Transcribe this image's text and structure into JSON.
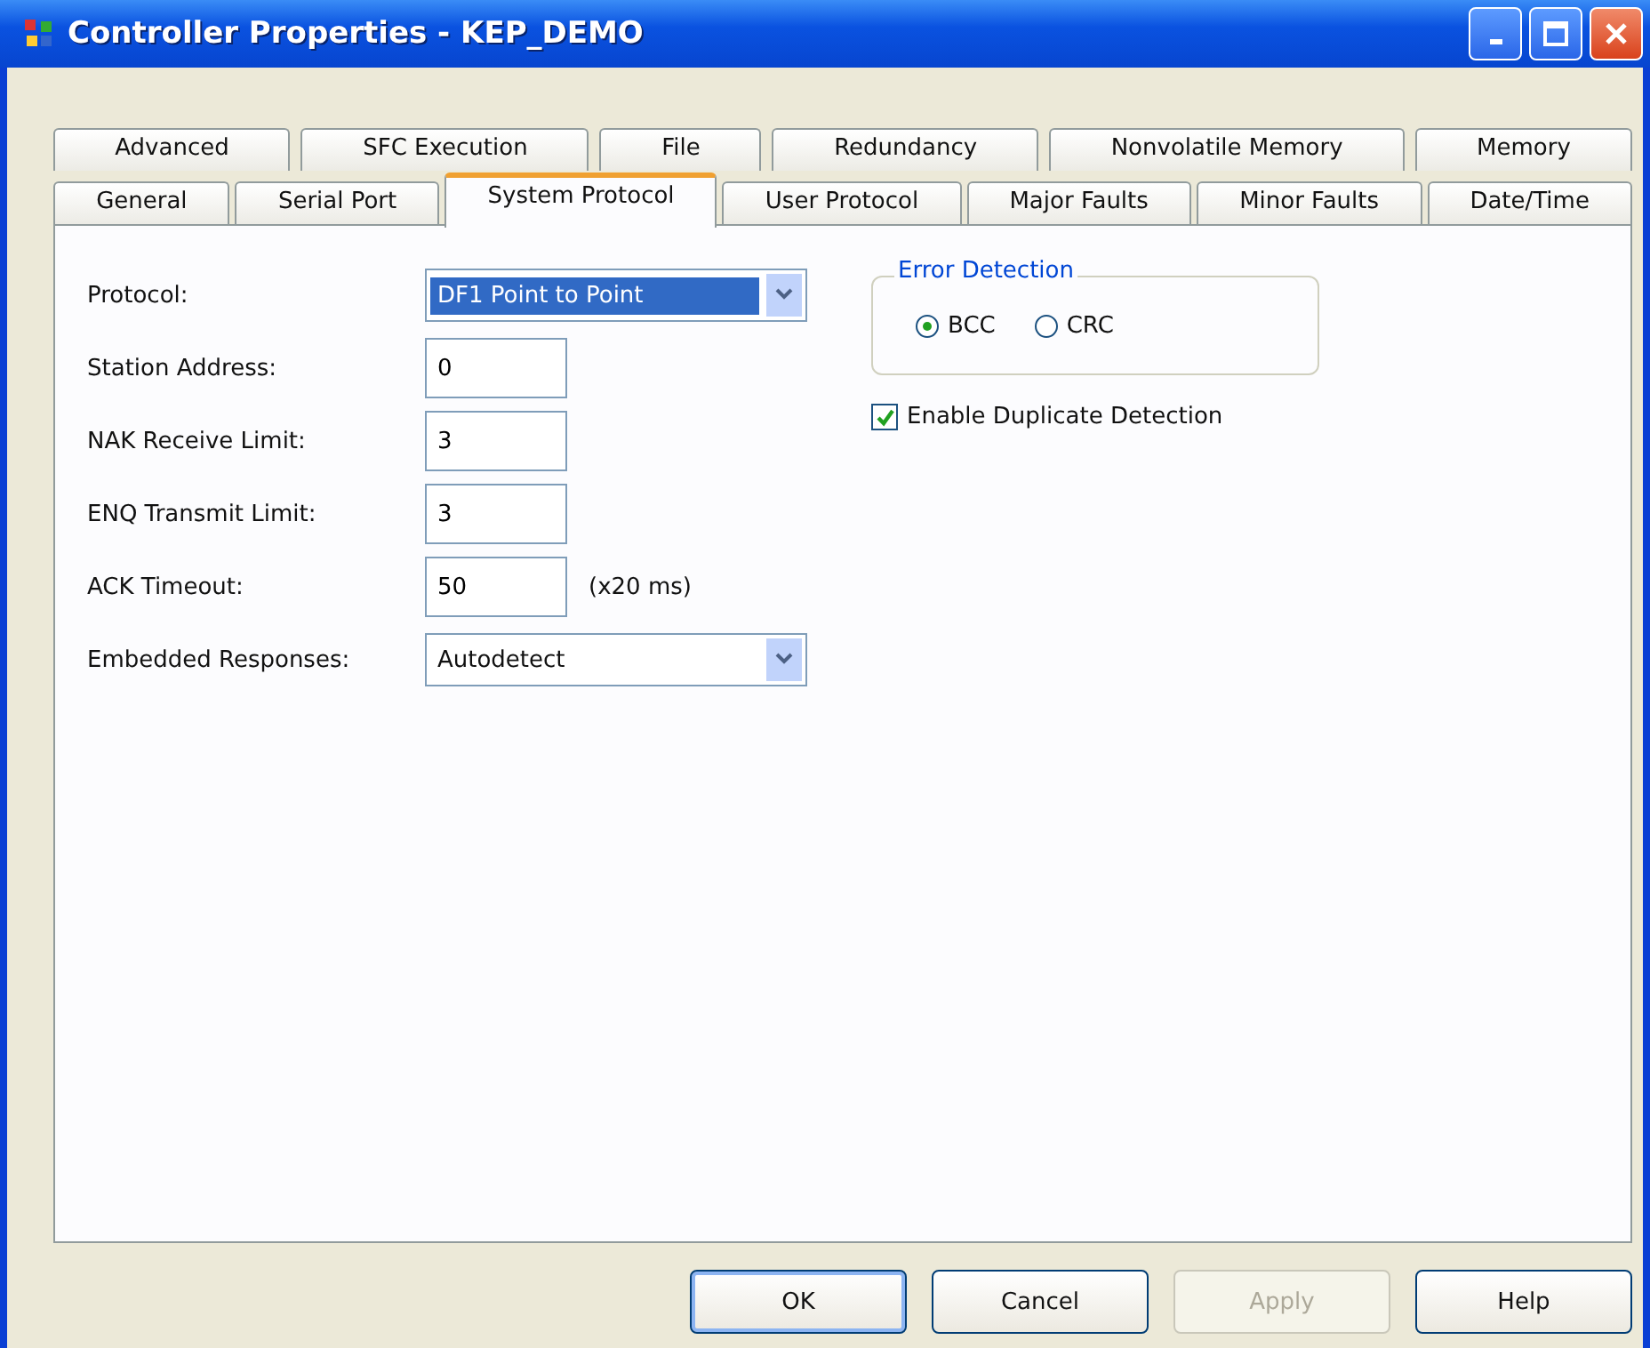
{
  "window": {
    "title": "Controller Properties - KEP_DEMO"
  },
  "tab_rows": [
    {
      "tabs": [
        {
          "label": "Advanced",
          "selected": false
        },
        {
          "label": "SFC Execution",
          "selected": false
        },
        {
          "label": "File",
          "selected": false
        },
        {
          "label": "Redundancy",
          "selected": false
        },
        {
          "label": "Nonvolatile Memory",
          "selected": false
        },
        {
          "label": "Memory",
          "selected": false
        }
      ]
    },
    {
      "tabs": [
        {
          "label": "General",
          "selected": false
        },
        {
          "label": "Serial Port",
          "selected": false
        },
        {
          "label": "System Protocol",
          "selected": true
        },
        {
          "label": "User Protocol",
          "selected": false
        },
        {
          "label": "Major Faults",
          "selected": false
        },
        {
          "label": "Minor Faults",
          "selected": false
        },
        {
          "label": "Date/Time",
          "selected": false
        }
      ]
    }
  ],
  "fields": [
    {
      "kind": "dropdown",
      "label": "Protocol:",
      "value": "DF1 Point to Point",
      "highlighted": true
    },
    {
      "kind": "text",
      "label": "Station Address:",
      "value": "0"
    },
    {
      "kind": "text",
      "label": "NAK Receive Limit:",
      "value": "3"
    },
    {
      "kind": "text",
      "label": "ENQ Transmit Limit:",
      "value": "3"
    },
    {
      "kind": "text",
      "label": "ACK Timeout:",
      "value": "50",
      "suffix": "(x20 ms)"
    },
    {
      "kind": "dropdown",
      "label": "Embedded Responses:",
      "value": "Autodetect",
      "highlighted": false
    }
  ],
  "error_detection": {
    "title": "Error Detection",
    "options": [
      {
        "label": "BCC",
        "selected": true
      },
      {
        "label": "CRC",
        "selected": false
      }
    ]
  },
  "duplicate_detection": {
    "label": "Enable Duplicate Detection",
    "checked": true
  },
  "buttons": [
    {
      "label": "OK",
      "disabled": false,
      "default": true
    },
    {
      "label": "Cancel",
      "disabled": false,
      "default": false
    },
    {
      "label": "Apply",
      "disabled": true,
      "default": false
    },
    {
      "label": "Help",
      "disabled": false,
      "default": false
    }
  ]
}
